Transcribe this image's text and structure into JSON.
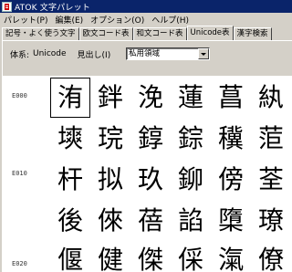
{
  "window": {
    "title": "ATOK 文字パレット"
  },
  "menu": [
    {
      "label": "パレット(P)"
    },
    {
      "label": "編集(E)"
    },
    {
      "label": "オプション(O)"
    },
    {
      "label": "ヘルプ(H)"
    }
  ],
  "tabs": [
    {
      "label": "記号・よく使う文字",
      "active": false
    },
    {
      "label": "欧文コード表",
      "active": false
    },
    {
      "label": "和文コード表",
      "active": false
    },
    {
      "label": "Unicode表",
      "active": true
    },
    {
      "label": "漢字検索",
      "active": false
    }
  ],
  "filters": {
    "system_label": "体系:",
    "system_value": "Unicode",
    "heading_label": "見出し(I)",
    "heading_value": "私用領域"
  },
  "grid": {
    "row_labels": [
      "E000",
      "E010",
      "E020"
    ],
    "rows": [
      [
        "洧",
        "鉡",
        "浼",
        "蓮",
        "菖",
        "紈"
      ],
      [
        "塽",
        "琓",
        "錞",
        "錝",
        "䆊",
        "菃"
      ],
      [
        "杆",
        "拟",
        "玖",
        "鉚",
        "傍",
        "荃"
      ],
      [
        "後",
        "倈",
        "蓓",
        "諂",
        "㯐",
        "璙"
      ],
      [
        "偃",
        "健",
        "傑",
        "倸",
        "滊",
        "僚"
      ]
    ],
    "selected": "洧"
  }
}
